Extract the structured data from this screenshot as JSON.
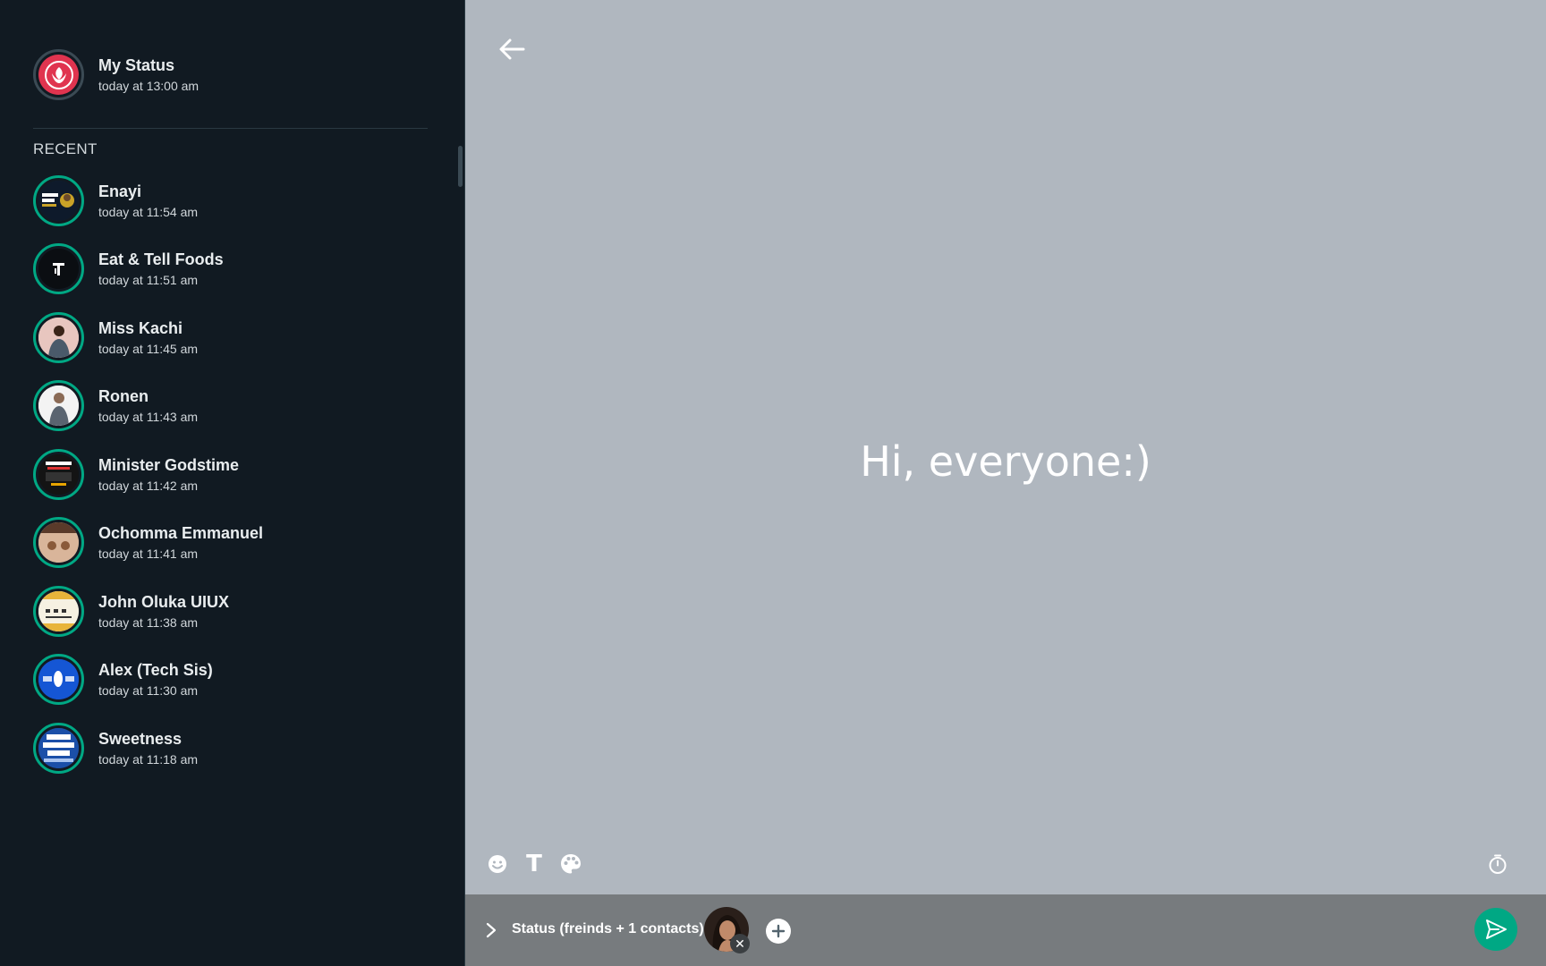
{
  "colors": {
    "accent": "#00a884",
    "sidebar_bg": "#111a22",
    "canvas_bg": "#b0b7bf",
    "bar_bg": "#777b7e"
  },
  "my_status": {
    "name": "My Status",
    "time": "today at 13:00 am",
    "icon": "my-status-avatar"
  },
  "section_label": "RECENT",
  "contacts": [
    {
      "name": "Enayi",
      "time": "today at 11:54 am"
    },
    {
      "name": "Eat & Tell Foods",
      "time": "today at 11:51 am"
    },
    {
      "name": "Miss Kachi",
      "time": "today at 11:45 am"
    },
    {
      "name": "Ronen",
      "time": "today at 11:43 am"
    },
    {
      "name": "Minister Godstime",
      "time": "today at 11:42 am"
    },
    {
      "name": "Ochomma Emmanuel",
      "time": "today at 11:41 am"
    },
    {
      "name": "John Oluka UIUX",
      "time": "today at 11:38 am"
    },
    {
      "name": "Alex (Tech Sis)",
      "time": "today at 11:30 am"
    },
    {
      "name": "Sweetness",
      "time": "today at 11:18 am"
    }
  ],
  "editor": {
    "status_text": "Hi, everyone:)",
    "tools": {
      "emoji": "emoji-icon",
      "text": "T",
      "palette": "palette-icon",
      "timer": "timer-icon"
    }
  },
  "footer": {
    "audience_label": "Status (freinds + 1 contacts)",
    "remove_glyph": "✕"
  }
}
